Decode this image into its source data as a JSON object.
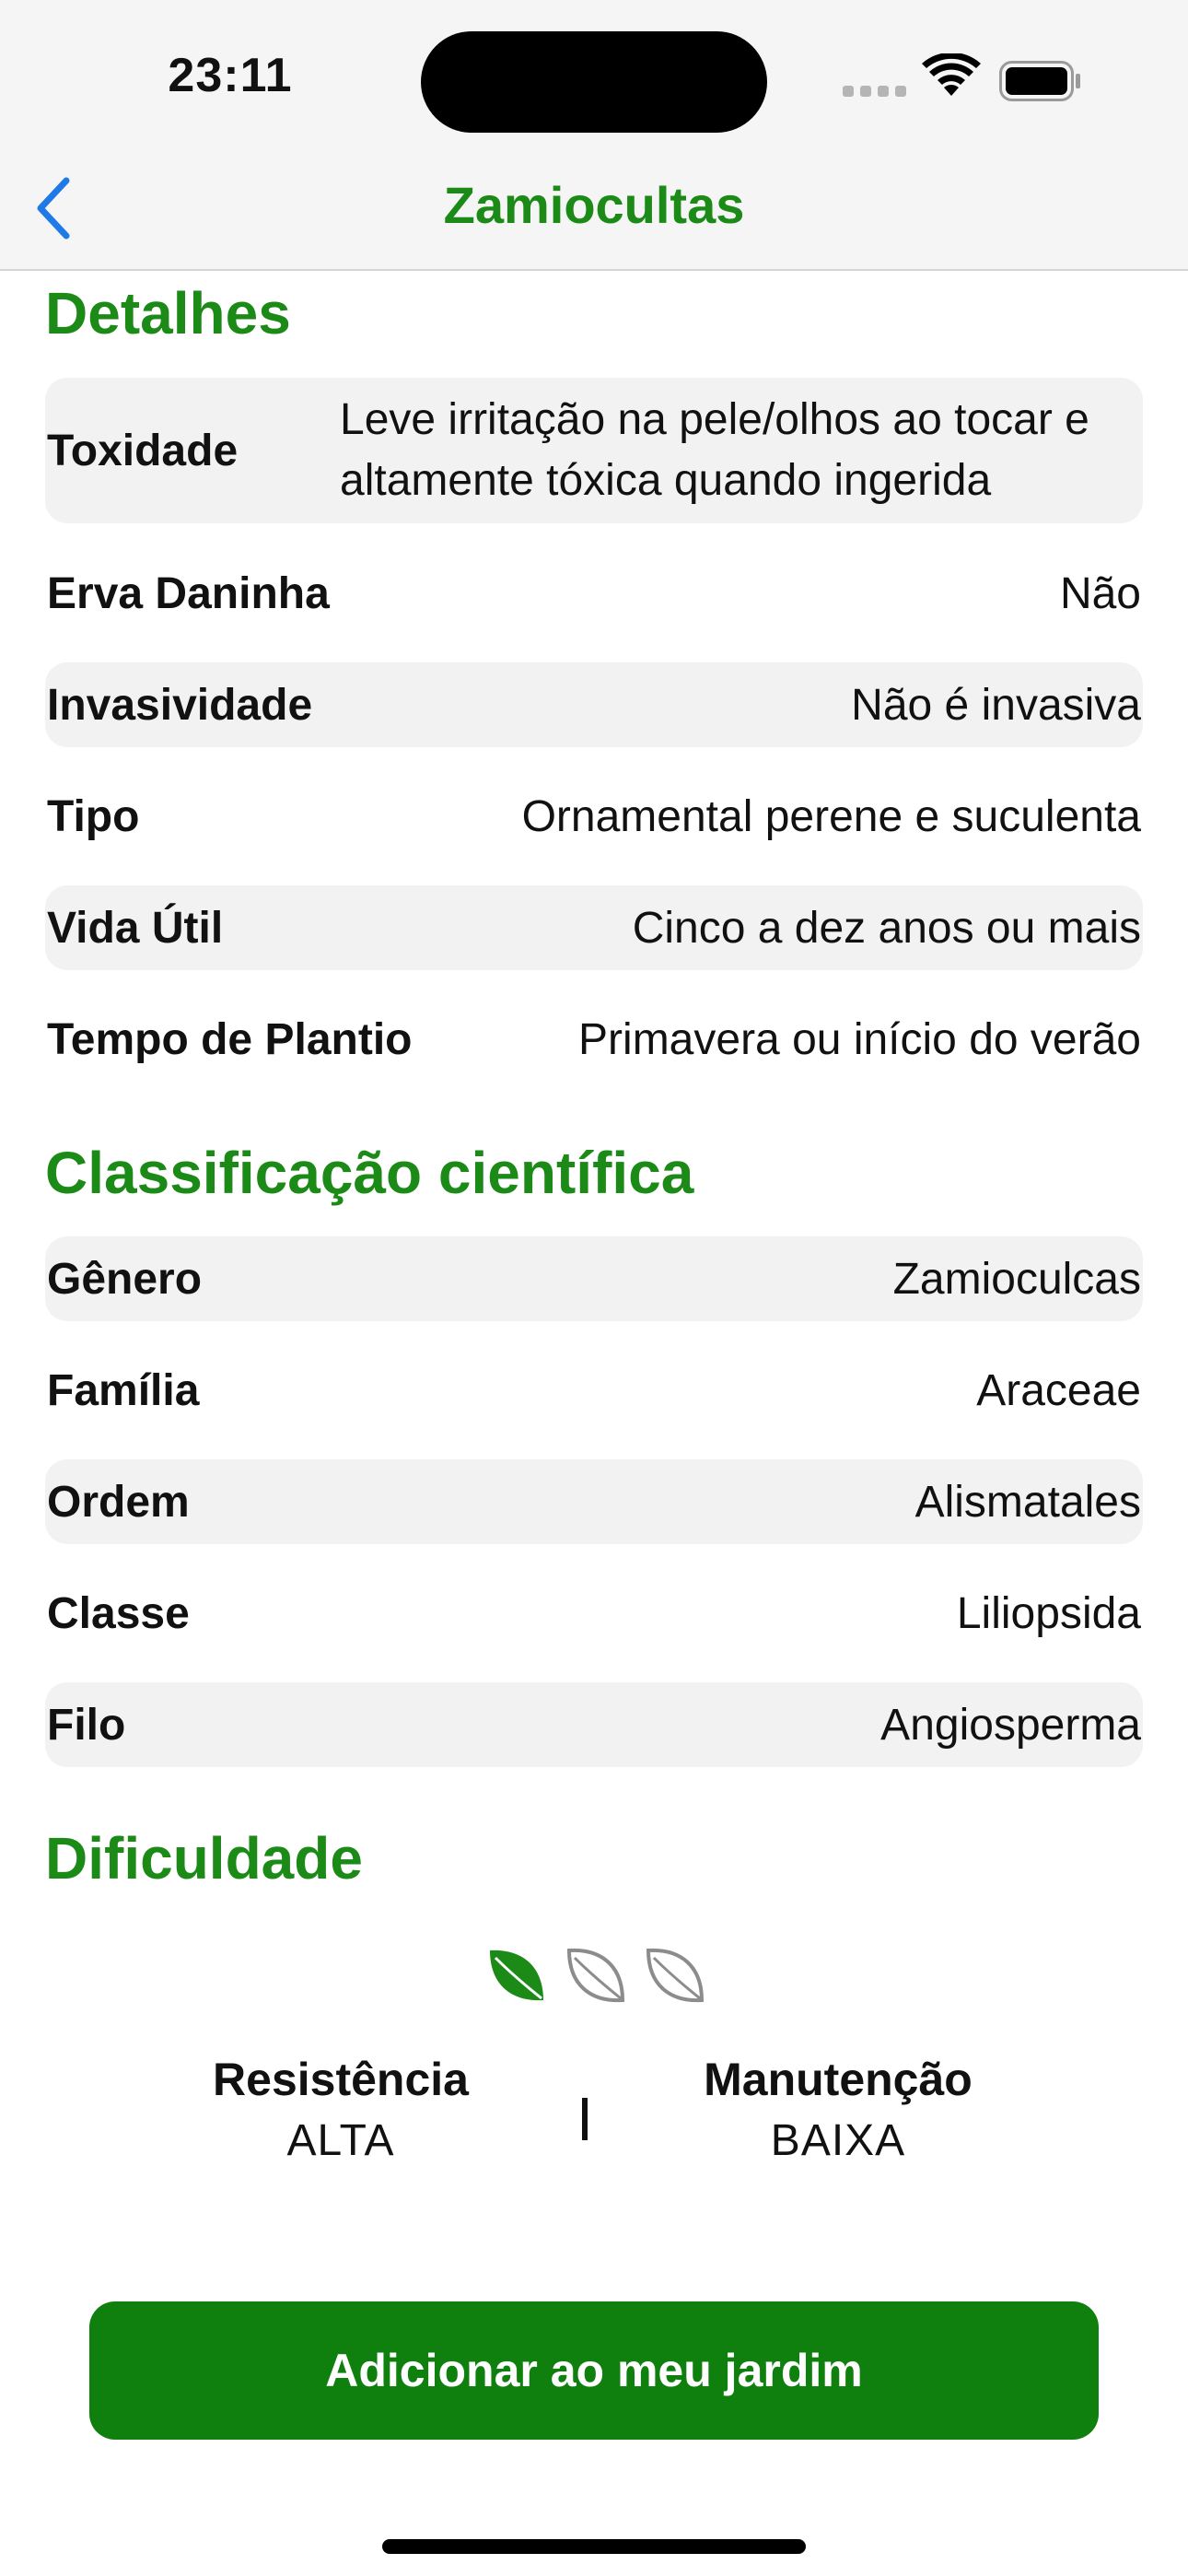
{
  "status_bar": {
    "time": "23:11"
  },
  "nav": {
    "title": "Zamiocultas",
    "back_icon": "chevron-left-icon"
  },
  "colors": {
    "accent": "#1c8a17",
    "button": "#0f7f0d",
    "row_shade": "#f2f2f2"
  },
  "details": {
    "title": "Detalhes",
    "rows": [
      {
        "label": "Toxidade",
        "value": "Leve irritação na pele/olhos ao tocar e altamente tóxica quando ingerida"
      },
      {
        "label": "Erva Daninha",
        "value": "Não"
      },
      {
        "label": "Invasividade",
        "value": "Não é invasiva"
      },
      {
        "label": "Tipo",
        "value": "Ornamental perene e suculenta"
      },
      {
        "label": "Vida Útil",
        "value": "Cinco a dez anos ou mais"
      },
      {
        "label": "Tempo de Plantio",
        "value": "Primavera ou início do verão"
      }
    ]
  },
  "classification": {
    "title": "Classificação científica",
    "rows": [
      {
        "label": "Gênero",
        "value": "Zamioculcas"
      },
      {
        "label": "Família",
        "value": "Araceae"
      },
      {
        "label": "Ordem",
        "value": "Alismatales"
      },
      {
        "label": "Classe",
        "value": "Liliopsida"
      },
      {
        "label": "Filo",
        "value": "Angiosperma"
      }
    ]
  },
  "difficulty": {
    "title": "Dificuldade",
    "level": 1,
    "max_level": 3,
    "icon": "leaf-icon",
    "resistance": {
      "label": "Resistência",
      "value": "ALTA"
    },
    "maintenance": {
      "label": "Manutenção",
      "value": "BAIXA"
    }
  },
  "action": {
    "add_label": "Adicionar ao meu jardim"
  }
}
